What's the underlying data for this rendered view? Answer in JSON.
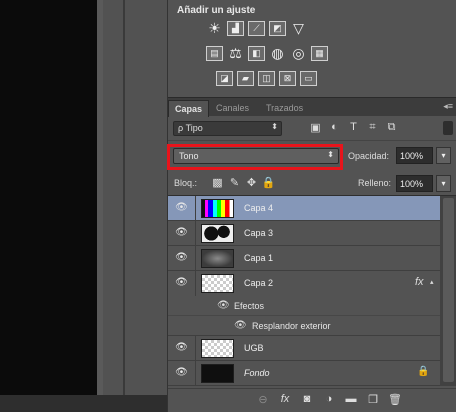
{
  "adjustments": {
    "title": "Añadir un ajuste",
    "row1": [
      {
        "icon": "brightness-icon",
        "glyph": "☀"
      },
      {
        "icon": "levels-icon",
        "glyph": "▟"
      },
      {
        "icon": "curves-icon",
        "glyph": "⟋"
      },
      {
        "icon": "exposure-icon",
        "glyph": "◩"
      },
      {
        "icon": "gradient-triangle-icon",
        "glyph": "▽"
      }
    ],
    "row2": [
      {
        "icon": "vibrance-icon",
        "glyph": "▤"
      },
      {
        "icon": "color-balance-icon",
        "glyph": "⚖"
      },
      {
        "icon": "black-white-icon",
        "glyph": "◧"
      },
      {
        "icon": "photo-filter-icon",
        "glyph": "◍"
      },
      {
        "icon": "channel-mixer-icon",
        "glyph": "◎"
      },
      {
        "icon": "color-lookup-icon",
        "glyph": "▦"
      }
    ],
    "row3": [
      {
        "icon": "invert-icon",
        "glyph": "◪"
      },
      {
        "icon": "posterize-icon",
        "glyph": "▰"
      },
      {
        "icon": "threshold-icon",
        "glyph": "◫"
      },
      {
        "icon": "selective-color-icon",
        "glyph": "⊠"
      },
      {
        "icon": "gradient-map-icon",
        "glyph": "▭"
      }
    ]
  },
  "tabs": [
    "Capas",
    "Canales",
    "Trazados"
  ],
  "filter": {
    "kind": "ρ Tipo",
    "icons": [
      {
        "icon": "pixel-filter-icon",
        "glyph": "▣"
      },
      {
        "icon": "adjustment-filter-icon",
        "glyph": "◐"
      },
      {
        "icon": "type-filter-icon",
        "glyph": "T"
      },
      {
        "icon": "shape-filter-icon",
        "glyph": "⌗"
      },
      {
        "icon": "smart-object-filter-icon",
        "glyph": "⧉"
      }
    ]
  },
  "blend": {
    "mode": "Tono",
    "opacity_label": "Opacidad:",
    "opacity_value": "100%"
  },
  "lock": {
    "label": "Bloq.:",
    "icons": [
      {
        "icon": "lock-transparent-icon",
        "glyph": "▩"
      },
      {
        "icon": "lock-brush-icon",
        "glyph": "✎"
      },
      {
        "icon": "lock-move-icon",
        "glyph": "✥"
      },
      {
        "icon": "lock-all-icon",
        "glyph": "🔒"
      }
    ],
    "fill_label": "Relleno:",
    "fill_value": "100%"
  },
  "layers": [
    {
      "name": "Capa 4",
      "thumb": "rainbow",
      "selected": true
    },
    {
      "name": "Capa 3",
      "thumb": "splash"
    },
    {
      "name": "Capa 1",
      "thumb": "gray"
    },
    {
      "name": "Capa 2",
      "thumb": "checker",
      "fx": "fx"
    },
    {
      "name": "UGB",
      "thumb": "checker"
    },
    {
      "name": "Fondo",
      "thumb": "black",
      "locked": true
    }
  ],
  "effects": {
    "header": "Efectos",
    "items": [
      "Resplandor exterior"
    ]
  },
  "bottom_icons": [
    {
      "icon": "link-layers-icon",
      "glyph": "⊖"
    },
    {
      "icon": "layer-style-icon",
      "glyph": "fx"
    },
    {
      "icon": "layer-mask-icon",
      "glyph": "◙"
    },
    {
      "icon": "new-adjustment-icon",
      "glyph": "◑"
    },
    {
      "icon": "new-group-icon",
      "glyph": "▬"
    },
    {
      "icon": "new-layer-icon",
      "glyph": "❐"
    },
    {
      "icon": "delete-layer-icon",
      "glyph": "🗑"
    }
  ],
  "colors": {
    "selected_row": "#8597b8",
    "highlight_box": "#e8141b",
    "panel_bg": "#535353"
  }
}
